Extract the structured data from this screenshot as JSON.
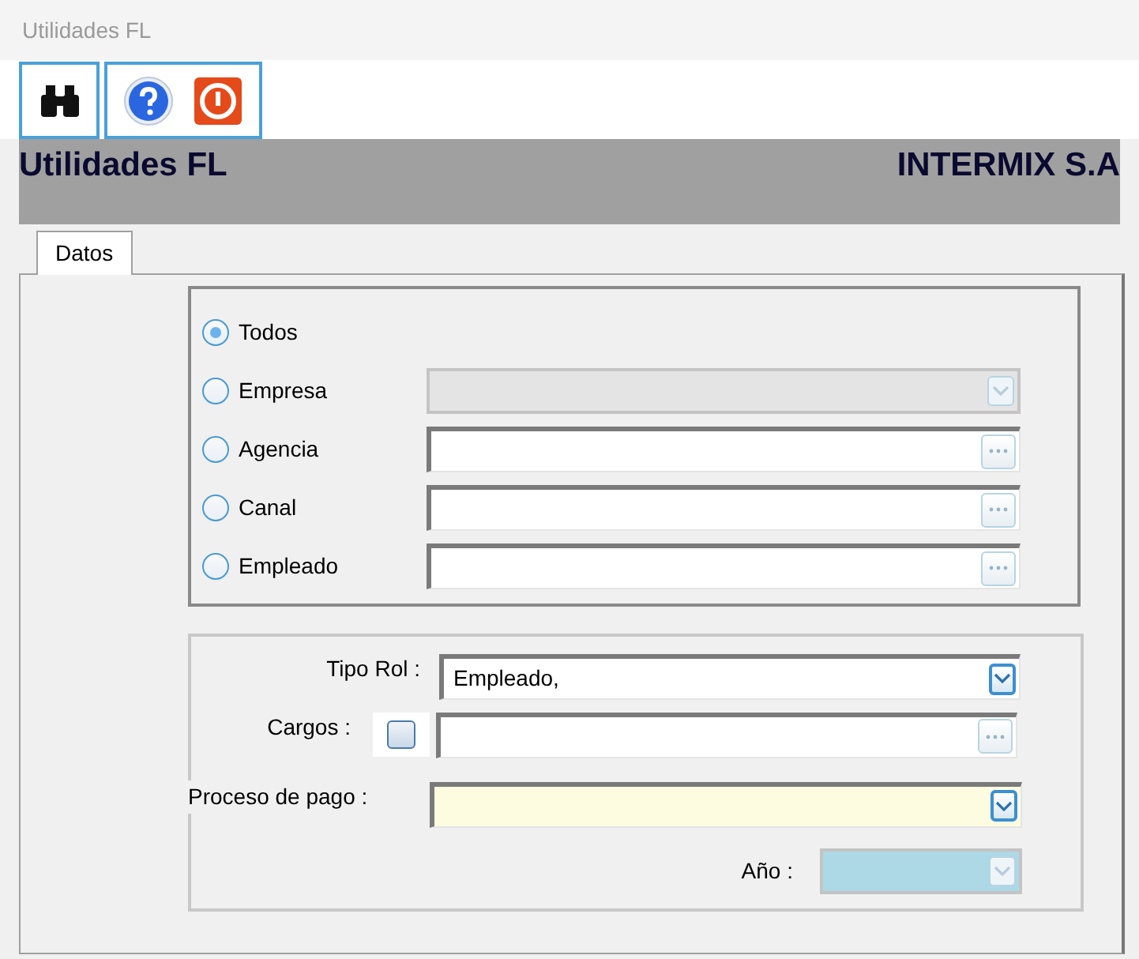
{
  "window": {
    "title": "Utilidades FL"
  },
  "header": {
    "title": "Utilidades FL",
    "company": "INTERMIX S.A"
  },
  "tabs": [
    {
      "label": "Datos",
      "selected": true
    }
  ],
  "filter_options": [
    {
      "label": "Todos",
      "selected": true
    },
    {
      "label": "Empresa",
      "selected": false,
      "field": {
        "kind": "combo",
        "disabled": true
      }
    },
    {
      "label": "Agencia",
      "selected": false,
      "field": {
        "kind": "lookup",
        "disabled": false
      }
    },
    {
      "label": "Canal",
      "selected": false,
      "field": {
        "kind": "lookup",
        "disabled": false
      }
    },
    {
      "label": "Empleado",
      "selected": false,
      "field": {
        "kind": "lookup",
        "disabled": false
      }
    }
  ],
  "parameters": {
    "tipo_rol": {
      "label": "Tipo Rol :",
      "value": "Empleado,"
    },
    "cargos": {
      "label": "Cargos :",
      "checked": false
    },
    "proceso_de_pago": {
      "label": "Proceso de pago :",
      "required": true
    },
    "anio": {
      "label": "Año :",
      "disabled": true
    }
  }
}
